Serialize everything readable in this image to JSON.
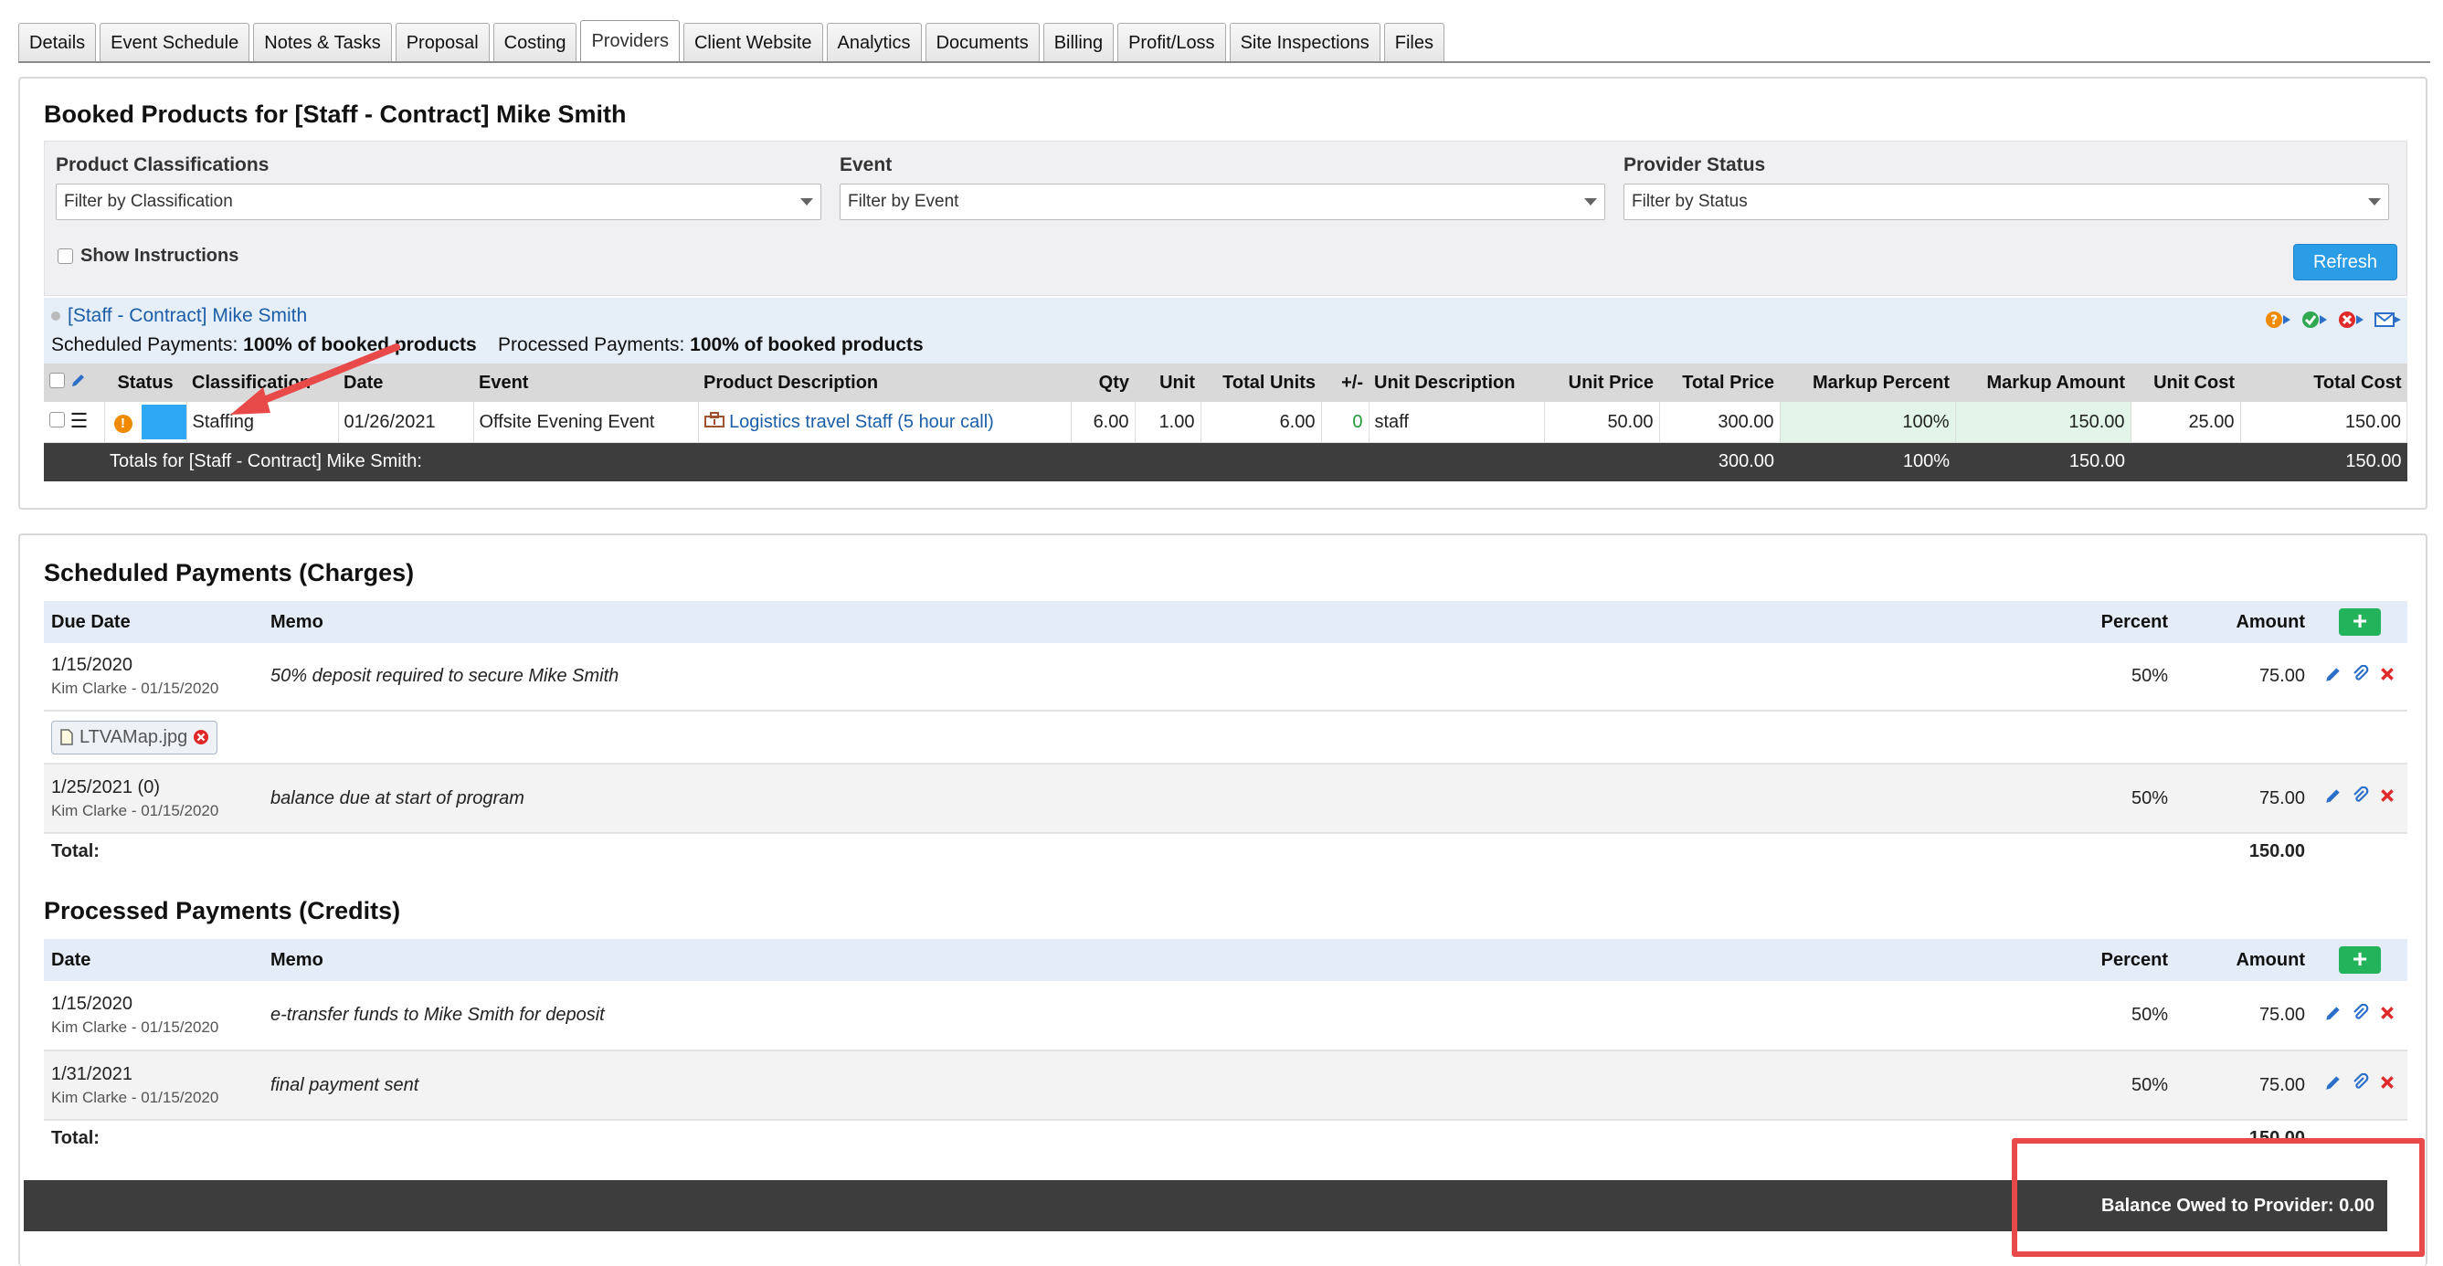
{
  "tabs": [
    "Details",
    "Event Schedule",
    "Notes & Tasks",
    "Proposal",
    "Costing",
    "Providers",
    "Client Website",
    "Analytics",
    "Documents",
    "Billing",
    "Profit/Loss",
    "Site Inspections",
    "Files"
  ],
  "active_tab": "Providers",
  "booked": {
    "title": "Booked Products for [Staff - Contract] Mike Smith",
    "filters": {
      "classification_label": "Product Classifications",
      "classification_placeholder": "Filter by Classification",
      "event_label": "Event",
      "event_placeholder": "Filter by Event",
      "status_label": "Provider Status",
      "status_placeholder": "Filter by Status"
    },
    "show_instructions": "Show Instructions",
    "refresh": "Refresh",
    "provider": {
      "name": "[Staff - Contract] Mike Smith",
      "scheduled_label": "Scheduled Payments:",
      "scheduled_value": "100% of booked products",
      "processed_label": "Processed Payments:",
      "processed_value": "100% of booked products"
    },
    "columns": {
      "status": "Status",
      "classification": "Classification",
      "date": "Date",
      "event": "Event",
      "product_description": "Product Description",
      "qty": "Qty",
      "unit": "Unit",
      "total_units": "Total Units",
      "plus_minus": "+/-",
      "unit_description": "Unit Description",
      "unit_price": "Unit Price",
      "total_price": "Total Price",
      "markup_percent": "Markup Percent",
      "markup_amount": "Markup Amount",
      "unit_cost": "Unit Cost",
      "total_cost": "Total Cost"
    },
    "row": {
      "classification": "Staffing",
      "date": "01/26/2021",
      "event": "Offsite Evening Event",
      "product_description": "Logistics travel Staff (5 hour call)",
      "qty": "6.00",
      "unit": "1.00",
      "total_units": "6.00",
      "plus_minus": "0",
      "unit_description": "staff",
      "unit_price": "50.00",
      "total_price": "300.00",
      "markup_percent": "100%",
      "markup_amount": "150.00",
      "unit_cost": "25.00",
      "total_cost": "150.00"
    },
    "totals": {
      "label": "Totals for [Staff - Contract] Mike Smith:",
      "total_price": "300.00",
      "markup_percent": "100%",
      "markup_amount": "150.00",
      "total_cost": "150.00"
    }
  },
  "scheduled": {
    "title": "Scheduled Payments (Charges)",
    "columns": {
      "date": "Due Date",
      "memo": "Memo",
      "percent": "Percent",
      "amount": "Amount"
    },
    "rows": [
      {
        "date": "1/15/2020",
        "by": "Kim Clarke - 01/15/2020",
        "memo": "50% deposit required to secure Mike Smith",
        "percent": "50%",
        "amount": "75.00"
      },
      {
        "date": "1/25/2021 (0)",
        "by": "Kim Clarke - 01/15/2020",
        "memo": "balance due at start of program",
        "percent": "50%",
        "amount": "75.00"
      }
    ],
    "attachment": "LTVAMap.jpg",
    "total_label": "Total:",
    "total_value": "150.00"
  },
  "processed": {
    "title": "Processed Payments (Credits)",
    "columns": {
      "date": "Date",
      "memo": "Memo",
      "percent": "Percent",
      "amount": "Amount"
    },
    "rows": [
      {
        "date": "1/15/2020",
        "by": "Kim Clarke - 01/15/2020",
        "memo": "e-transfer funds to Mike Smith for deposit",
        "percent": "50%",
        "amount": "75.00"
      },
      {
        "date": "1/31/2021",
        "by": "Kim Clarke - 01/15/2020",
        "memo": "final payment sent",
        "percent": "50%",
        "amount": "75.00"
      }
    ],
    "total_label": "Total:",
    "total_value": "150.00"
  },
  "balance": "Balance Owed to Provider: 0.00",
  "colors": {
    "accent": "#2b9ce6",
    "status_blue": "#2ea7f5",
    "add_green": "#23b35b",
    "annotation_red": "#e84a4a",
    "dark_bar": "#3d3d3d"
  }
}
